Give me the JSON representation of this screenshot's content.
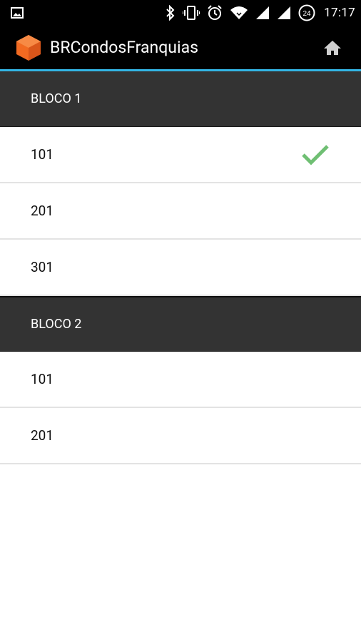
{
  "status_bar": {
    "time": "17:17",
    "battery_level_label": "24",
    "icons": [
      "image-notification-icon",
      "bluetooth-icon",
      "vibrate-icon",
      "alarm-icon",
      "wifi-icon",
      "signal-icon",
      "signal-icon-2",
      "battery-icon"
    ]
  },
  "action_bar": {
    "title": "BRCondosFranquias",
    "app_icon": "orange-cube-icon",
    "home_icon": "home-icon"
  },
  "colors": {
    "accent": "#33b5e5",
    "section_bg": "#333333",
    "check": "#6fbf73",
    "app_icon": "#f26a21"
  },
  "sections": [
    {
      "label": "BLOCO 1",
      "rows": [
        {
          "label": "101",
          "checked": true
        },
        {
          "label": "201",
          "checked": false
        },
        {
          "label": "301",
          "checked": false
        }
      ]
    },
    {
      "label": "BLOCO 2",
      "rows": [
        {
          "label": "101",
          "checked": false
        },
        {
          "label": "201",
          "checked": false
        }
      ]
    }
  ]
}
